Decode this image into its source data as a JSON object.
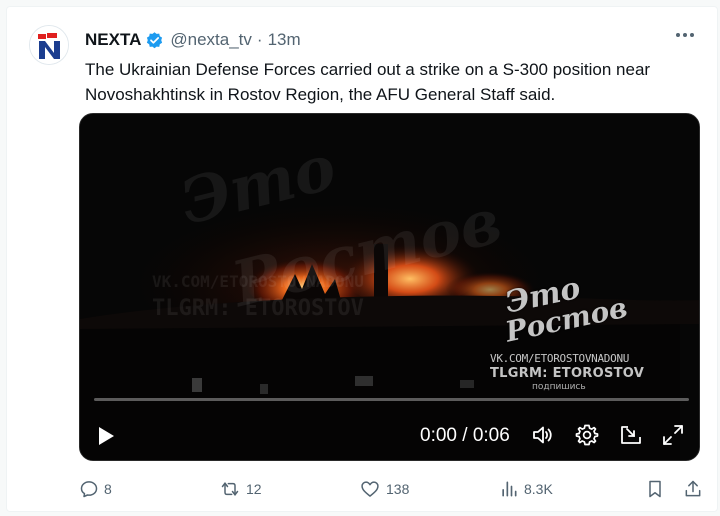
{
  "tweet": {
    "author_name": "NEXTA",
    "handle": "@nexta_tv",
    "separator": "·",
    "time": "13m",
    "text": "The Ukrainian Defense Forces carried out a strike on a S-300 position near Novoshakhtinsk in Rostov Region, the AFU General Staff said."
  },
  "video": {
    "watermark": {
      "line1": "Это",
      "line2": "Ростов",
      "url": "VK.COM/ETOROSTOVNADONU",
      "telegram": "TLGRM: ETOROSTOV",
      "subscribe": "подпишись"
    },
    "time_display": "0:00 / 0:06",
    "progress": 0.0,
    "controls": {
      "play": "play-icon",
      "volume": "volume-icon",
      "settings": "settings-gear-icon",
      "pip": "picture-in-picture-icon",
      "fullscreen": "fullscreen-icon"
    }
  },
  "actions": {
    "replies": "8",
    "reposts": "12",
    "likes": "138",
    "views": "8.3K"
  },
  "colors": {
    "text": "#0f1419",
    "secondary": "#536471",
    "verified": "#1d9bf0",
    "brand_red": "#e0201f",
    "brand_blue": "#1b3d8f"
  }
}
